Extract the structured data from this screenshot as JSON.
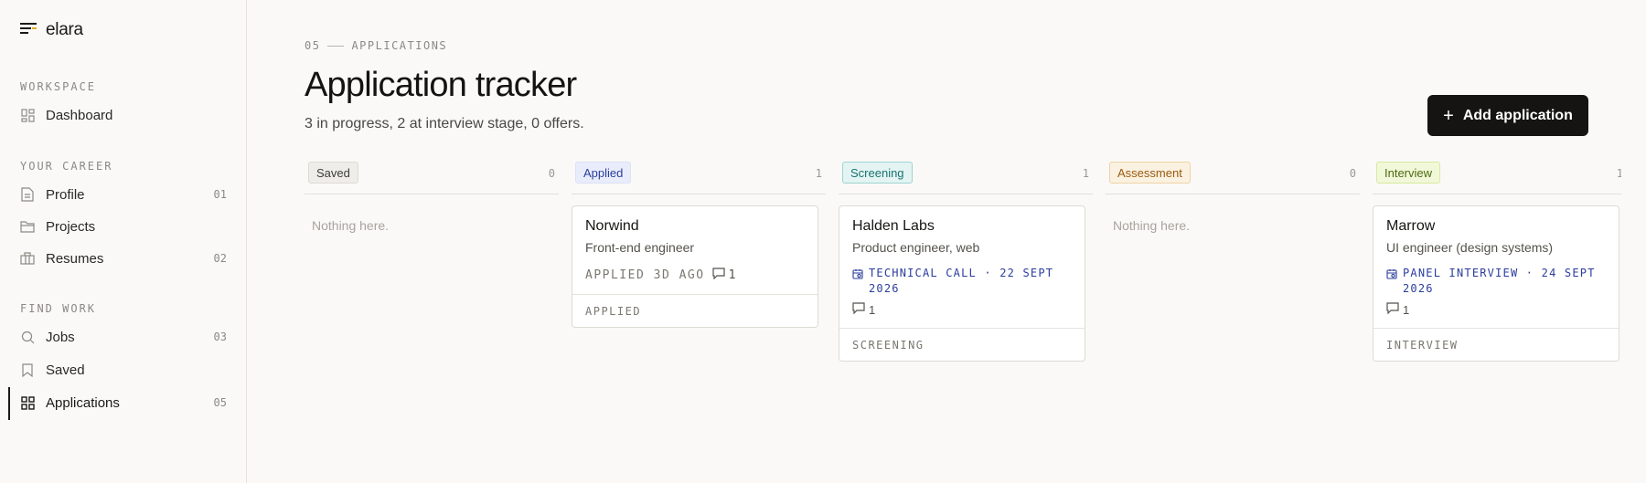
{
  "brand": {
    "name": "elara"
  },
  "sidebar": {
    "sections": [
      {
        "label": "WORKSPACE"
      },
      {
        "label": "YOUR CAREER"
      },
      {
        "label": "FIND WORK"
      }
    ],
    "items": [
      {
        "label": "Dashboard",
        "count": "",
        "icon": "dashboard-icon"
      },
      {
        "label": "Profile",
        "count": "01",
        "icon": "document-icon"
      },
      {
        "label": "Projects",
        "count": "",
        "icon": "folder-icon"
      },
      {
        "label": "Resumes",
        "count": "02",
        "icon": "briefcase-icon"
      },
      {
        "label": "Jobs",
        "count": "03",
        "icon": "search-icon"
      },
      {
        "label": "Saved",
        "count": "",
        "icon": "bookmark-icon"
      },
      {
        "label": "Applications",
        "count": "05",
        "icon": "grid-icon",
        "active": true
      }
    ]
  },
  "header": {
    "eyebrow_number": "05",
    "eyebrow_label": "APPLICATIONS",
    "title": "Application tracker",
    "subtitle": "3 in progress, 2 at interview stage, 0 offers.",
    "add_button": "Add application"
  },
  "board": {
    "empty_text": "Nothing here.",
    "columns": [
      {
        "label": "Saved",
        "count": "0",
        "color": "#3e3c38"
      },
      {
        "label": "Applied",
        "count": "1",
        "color": "#2b3d9c"
      },
      {
        "label": "Screening",
        "count": "1",
        "color": "#197470"
      },
      {
        "label": "Assessment",
        "count": "0",
        "color": "#9a5a10"
      },
      {
        "label": "Interview",
        "count": "1",
        "color": "#4d6a0e"
      }
    ],
    "cards": {
      "applied": {
        "company": "Norwind",
        "role": "Front-end engineer",
        "meta": "APPLIED 3D AGO",
        "comments": "1",
        "stage": "APPLIED"
      },
      "screening": {
        "company": "Halden Labs",
        "role": "Product engineer, web",
        "event_line1": "TECHNICAL CALL · 22 SEPT",
        "event_line2": "2026",
        "comments": "1",
        "stage": "SCREENING"
      },
      "interview": {
        "company": "Marrow",
        "role": "UI engineer (design systems)",
        "event_line1": "PANEL INTERVIEW · 24 SEPT",
        "event_line2": "2026",
        "comments": "1",
        "stage": "INTERVIEW"
      }
    }
  }
}
